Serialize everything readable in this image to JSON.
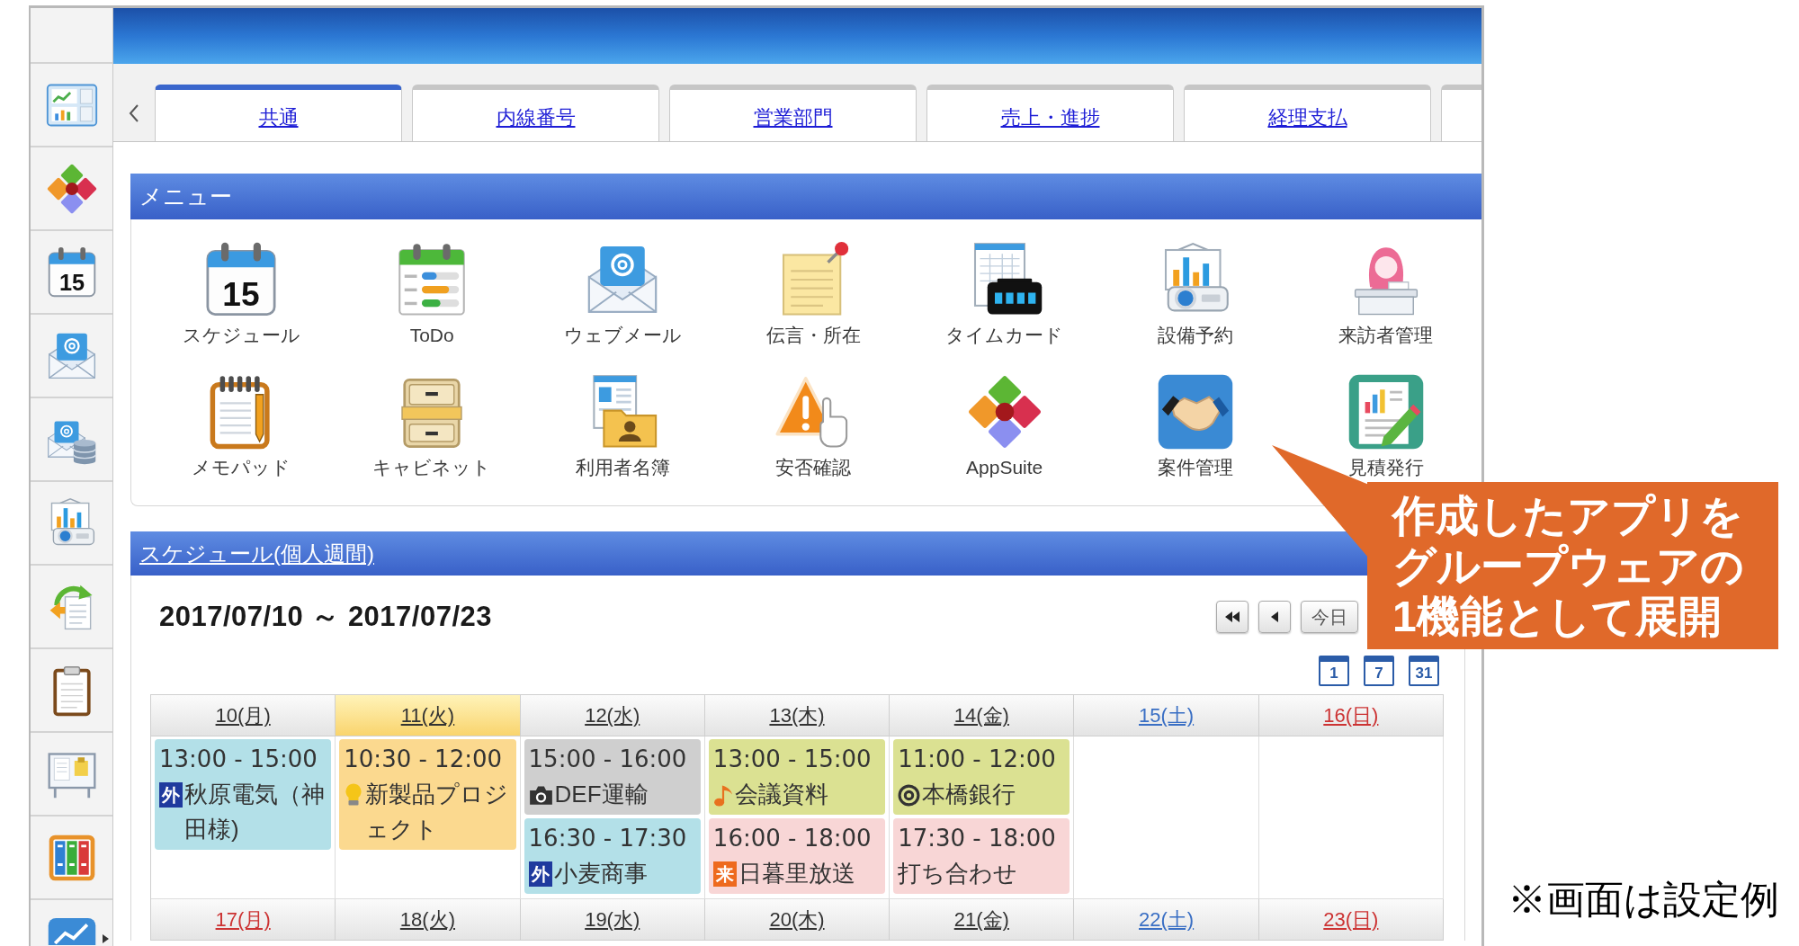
{
  "sidebar": {
    "calendar_day": "15"
  },
  "tabs": [
    {
      "label": "共通",
      "selected": true
    },
    {
      "label": "内線番号",
      "selected": false
    },
    {
      "label": "営業部門",
      "selected": false
    },
    {
      "label": "売上・進捗",
      "selected": false
    },
    {
      "label": "経理支払",
      "selected": false
    }
  ],
  "menu": {
    "title": "メニュー",
    "items": [
      {
        "label": "スケジュール",
        "icon_text": "15"
      },
      {
        "label": "ToDo"
      },
      {
        "label": "ウェブメール"
      },
      {
        "label": "伝言・所在"
      },
      {
        "label": "タイムカード"
      },
      {
        "label": "設備予約"
      },
      {
        "label": "来訪者管理"
      },
      {
        "label": "メモパッド"
      },
      {
        "label": "キャビネット"
      },
      {
        "label": "利用者名簿"
      },
      {
        "label": "安否確認"
      },
      {
        "label": "AppSuite"
      },
      {
        "label": "案件管理"
      },
      {
        "label": "見積発行"
      }
    ]
  },
  "schedule": {
    "title": "スケジュール(個人週間)",
    "range": "2017/07/10 ～ 2017/07/23",
    "today_button": "今日",
    "view_buttons": [
      "1",
      "7",
      "31"
    ],
    "weeks": [
      {
        "days": [
          {
            "label": "10(月)",
            "today": false,
            "color": "#333333",
            "events": [
              {
                "time": "13:00 - 15:00",
                "title": "秋原電気（神田様)",
                "color": "#b3e0e8",
                "kind": "badge",
                "badge": {
                  "text": "外",
                  "color": "#1f3a9e"
                }
              }
            ]
          },
          {
            "label": "11(火)",
            "today": true,
            "color": "#333333",
            "events": [
              {
                "time": "10:30 - 12:00",
                "title": "新製品プロジェクト",
                "color": "#fbd98f",
                "kind": "bulb"
              }
            ]
          },
          {
            "label": "12(水)",
            "today": false,
            "color": "#333333",
            "events": [
              {
                "time": "15:00 - 16:00",
                "title": "DEF運輸",
                "color": "#cfcfcf",
                "kind": "camera"
              },
              {
                "time": "16:30 - 17:30",
                "title": "小麦商事",
                "color": "#b3e0e8",
                "kind": "badge",
                "badge": {
                  "text": "外",
                  "color": "#1f3a9e"
                }
              }
            ]
          },
          {
            "label": "13(木)",
            "today": false,
            "color": "#333333",
            "events": [
              {
                "time": "13:00 - 15:00",
                "title": "会議資料",
                "color": "#dbe192",
                "kind": "music"
              },
              {
                "time": "16:00 - 18:00",
                "title": "日暮里放送",
                "color": "#f8d6d6",
                "kind": "badge",
                "badge": {
                  "text": "来",
                  "color": "#ee6a1e"
                }
              }
            ]
          },
          {
            "label": "14(金)",
            "today": false,
            "color": "#333333",
            "events": [
              {
                "time": "11:00 - 12:00",
                "title": "本橋銀行",
                "color": "#dbe192",
                "kind": "target"
              },
              {
                "time": "17:30 - 18:00",
                "title": "打ち合わせ",
                "color": "#f8d6d6",
                "kind": "plain"
              }
            ]
          },
          {
            "label": "15(土)",
            "today": false,
            "color": "#3a6fc4"
          },
          {
            "label": "16(日)",
            "today": false,
            "color": "#cc3333"
          }
        ]
      },
      {
        "days": [
          {
            "label": "17(月)",
            "today": false,
            "color": "#cc3333"
          },
          {
            "label": "18(火)",
            "today": false,
            "color": "#333333"
          },
          {
            "label": "19(水)",
            "today": false,
            "color": "#333333"
          },
          {
            "label": "20(木)",
            "today": false,
            "color": "#333333"
          },
          {
            "label": "21(金)",
            "today": false,
            "color": "#333333"
          },
          {
            "label": "22(土)",
            "today": false,
            "color": "#3a6fc4"
          },
          {
            "label": "23(日)",
            "today": false,
            "color": "#cc3333"
          }
        ]
      }
    ]
  },
  "callout": {
    "lines": [
      "作成したアプリを",
      "グループウェアの",
      "1機能として展開"
    ]
  },
  "note": "※画面は設定例"
}
